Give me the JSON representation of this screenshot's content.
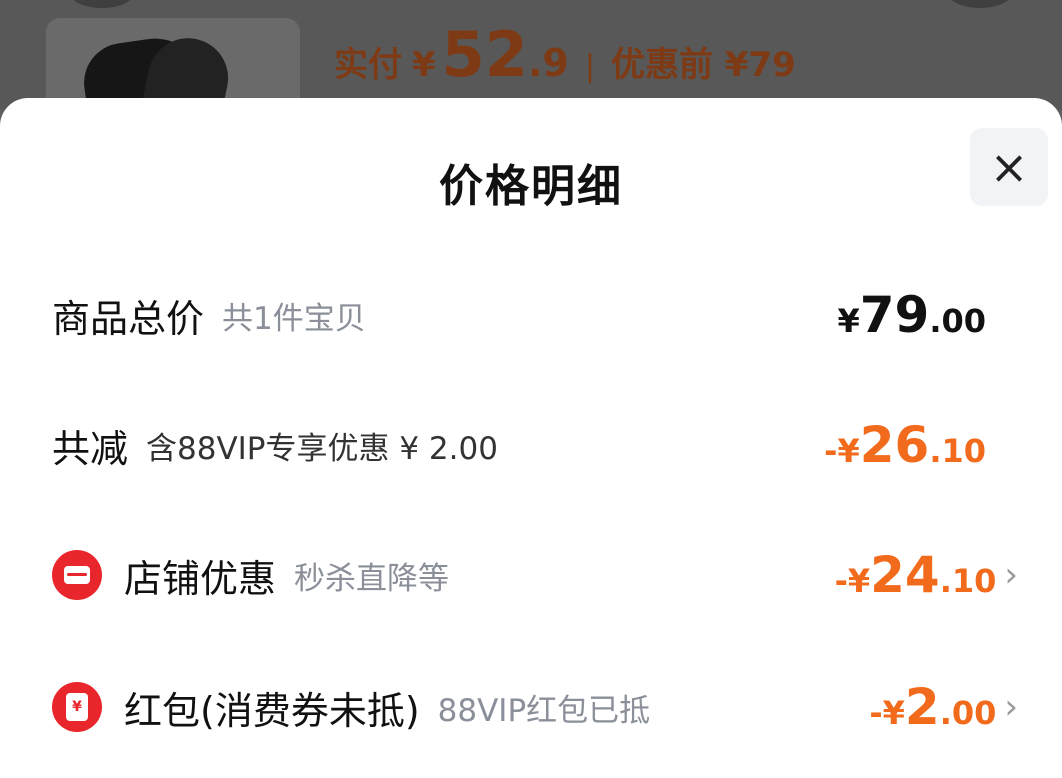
{
  "background_header": {
    "paid_label": "实付",
    "paid_currency": "¥",
    "paid_int": "52",
    "paid_dec": ".9",
    "separator": "|",
    "original_label": "优惠前 ¥79"
  },
  "sheet": {
    "title": "价格明细",
    "close_label": "×"
  },
  "rows": {
    "total": {
      "title": "商品总价",
      "sub": "共1件宝贝",
      "currency": "¥",
      "int": "79",
      "dec": ".00"
    },
    "reduction": {
      "title": "共减",
      "sub": "含88VIP专享优惠 ¥ 2.00",
      "sign_currency": "-¥",
      "int": "26",
      "dec": ".10"
    },
    "shop_discount": {
      "icon": "shop-icon",
      "title": "店铺优惠",
      "sub": "秒杀直降等",
      "sign_currency": "-¥",
      "int": "24",
      "dec": ".10",
      "chevron": "›"
    },
    "red_packet": {
      "icon": "red-packet-icon",
      "icon_glyph": "¥",
      "title": "红包(消费券未抵)",
      "sub": "88VIP红包已抵",
      "sign_currency": "-¥",
      "int": "2",
      "dec": ".00",
      "chevron": "›"
    }
  },
  "colors": {
    "accent_orange": "#f26b1d",
    "icon_red": "#e8262b",
    "muted_text": "#8a8f99"
  }
}
